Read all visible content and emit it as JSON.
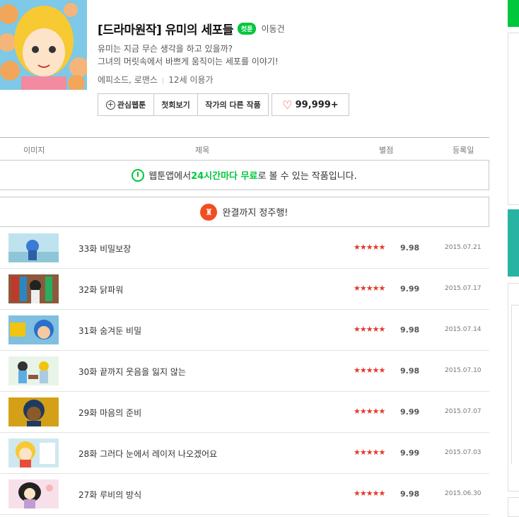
{
  "webtoon": {
    "title": "[드라마원작] 유미의 세포들",
    "badge": "컷툰",
    "author": "이동건",
    "description": [
      "유미는 지금 무슨 생각을 하고 있을까?",
      "그녀의 머릿속에서 바쁘게 움직이는 세포를 이야기!"
    ],
    "genre": "에피소드, 로맨스",
    "age": "12세 이용가"
  },
  "actions": {
    "favorite_label": "관심웹툰",
    "first_episode_label": "첫회보기",
    "other_works_label": "작가의 다른 작품",
    "like_count": "99,999+"
  },
  "table_header": {
    "image": "이미지",
    "title": "제목",
    "rating": "별점",
    "date": "등록일"
  },
  "notice_free": {
    "prefix": "웹툰앱에서 ",
    "highlight": "24시간마다 무료",
    "suffix": "로 볼 수 있는 작품입니다."
  },
  "notice_complete": {
    "text": "완결까지 정주행!"
  },
  "stars_text": "★★★★★",
  "episodes": [
    {
      "title": "33화 비밀보장",
      "score": "9.98",
      "date": "2015.07.21"
    },
    {
      "title": "32화 닭파워",
      "score": "9.99",
      "date": "2015.07.17"
    },
    {
      "title": "31화 숨겨둔 비밀",
      "score": "9.98",
      "date": "2015.07.14"
    },
    {
      "title": "30화 끝까지 웃음을 잃지 않는",
      "score": "9.98",
      "date": "2015.07.10"
    },
    {
      "title": "29화 마음의 준비",
      "score": "9.99",
      "date": "2015.07.07"
    },
    {
      "title": "28화 그러다 눈에서 레이저 나오겠어요",
      "score": "9.99",
      "date": "2015.07.03"
    },
    {
      "title": "27화 루비의 방식",
      "score": "9.98",
      "date": "2015.06.30"
    }
  ],
  "colors": {
    "accent_green": "#00c73c",
    "star_red": "#e4392b",
    "teal": "#29b3a2",
    "castle_orange": "#f04e23"
  }
}
